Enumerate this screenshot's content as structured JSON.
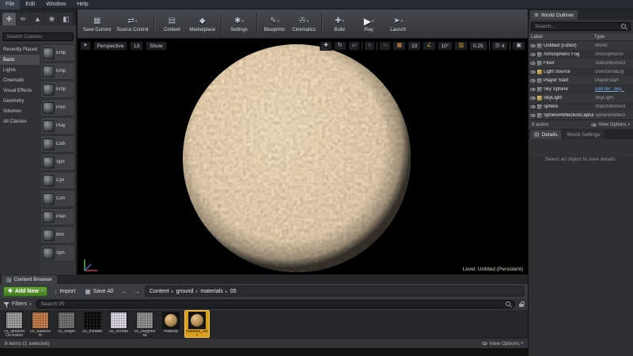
{
  "menubar": {
    "items": [
      "File",
      "Edit",
      "Window",
      "Help"
    ]
  },
  "toolbar": {
    "buttons": [
      "Save Current",
      "Source Control",
      "Content",
      "Marketplace",
      "Settings",
      "Blueprints",
      "Cinematics",
      "Build",
      "Play",
      "Launch"
    ]
  },
  "icons": {
    "caret": "▾",
    "save": "▦",
    "source_control": "⇄",
    "content": "▤",
    "marketplace": "◆",
    "settings": "✱",
    "blueprints": "✎",
    "cinematics": "✇",
    "build": "✚",
    "play": "▶",
    "launch": "➤",
    "back": "←",
    "forward": "→",
    "crumb_sep": "▸",
    "import": "↓",
    "plus": "✚",
    "move": "✚",
    "rotate": "↻",
    "scale": "▱",
    "world": "○",
    "surface_snap": "∩",
    "grid": "▦",
    "angle": "∠",
    "scale_snap": "▥",
    "camera": "◎",
    "maximize": "▣",
    "globe": "⊕",
    "panel": "▤",
    "mode_place": "✛",
    "mode_paint": "✏",
    "mode_landscape": "▲",
    "mode_foliage": "❀",
    "mode_geometry": "◧"
  },
  "colors": {
    "accent_orange": "#e09a3c",
    "selection_yellow": "#d99e1c",
    "add_new_green": "#4e8f2a",
    "link_blue": "#76aee6",
    "sphere_base": "#c79e66"
  },
  "modes": {
    "search_placeholder": "Search Classes",
    "categories": [
      "Recently Placed",
      "Basic",
      "Lights",
      "Cinematic",
      "Visual Effects",
      "Geometry",
      "Volumes",
      "All Classes"
    ],
    "active_category": "Basic",
    "items": [
      "Emp",
      "Emp",
      "Emp",
      "Poin",
      "Play",
      "Cub",
      "Sph",
      "Cyli",
      "Con",
      "Plan",
      "Box",
      "Sph"
    ]
  },
  "viewport": {
    "perspective_label": "Perspective",
    "lit_label": "Lit",
    "show_label": "Show",
    "grid_snap": "10",
    "rotation_snap": "10°",
    "scale_snap": "0.25",
    "camera_speed": "4",
    "level_label": "Level: Untitled (Persistent)"
  },
  "outliner": {
    "tab_label": "World Outliner",
    "search_placeholder": "Search...",
    "col_label": "Label",
    "col_type": "Type",
    "rows": [
      {
        "label": "Untitled (Editor)",
        "type": "World"
      },
      {
        "label": "Atmospheric Fog",
        "type": "AtmosphericF"
      },
      {
        "label": "Floor",
        "type": "StaticMeshAct"
      },
      {
        "label": "Light Source",
        "type": "DirectionalLig"
      },
      {
        "label": "Player Start",
        "type": "PlayerStart"
      },
      {
        "label": "Sky Sphere",
        "type": "Edit BP_Sky_"
      },
      {
        "label": "SkyLight",
        "type": "SkyLight"
      },
      {
        "label": "sphere",
        "type": "StaticMeshAct"
      },
      {
        "label": "SphereReflectionCapture",
        "type": "SphereReflect"
      }
    ],
    "actor_count": "8 actors",
    "view_options": "View Options"
  },
  "details": {
    "tab_details": "Details",
    "tab_world_settings": "World Settings",
    "empty_message": "Select an object to view details."
  },
  "content_browser": {
    "tab_label": "Content Browser",
    "add_new": "Add New",
    "import": "Import",
    "save_all": "Save All",
    "breadcrumbs": [
      "Content",
      "ground",
      "materials",
      "05"
    ],
    "filters": "Filters",
    "search_placeholder": "Search 05",
    "assets": [
      {
        "name": "05_ambient Occlusion",
        "color": "#9a9a9a",
        "kind": "texture"
      },
      {
        "name": "05_basecolor",
        "color": "#c07a48",
        "kind": "texture"
      },
      {
        "name": "05_height",
        "color": "#6e6e6e",
        "kind": "texture"
      },
      {
        "name": "05_metallic",
        "color": "#0c0c0c",
        "kind": "texture"
      },
      {
        "name": "05_normal",
        "color": "#d8d4e4",
        "kind": "texture"
      },
      {
        "name": "05_roughness",
        "color": "#8d8d8d",
        "kind": "texture"
      },
      {
        "name": "material",
        "color": "#161616",
        "kind": "material"
      },
      {
        "name": "material_Inst",
        "color": "#161616",
        "kind": "material",
        "selected": true
      }
    ],
    "status": "8 items (1 selected)",
    "view_options": "View Options"
  }
}
